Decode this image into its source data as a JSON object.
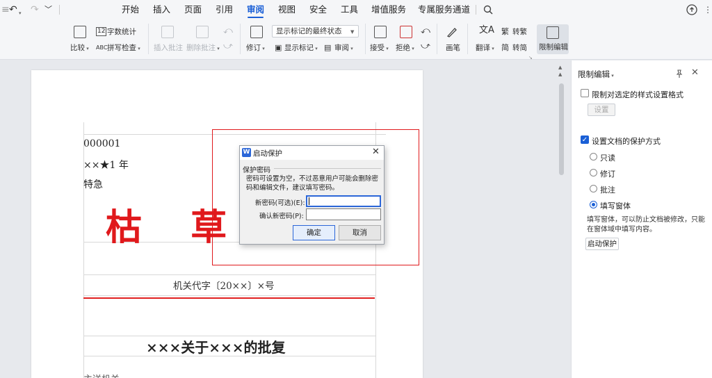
{
  "quick_access": {
    "undo_icon": "↶",
    "redo_icon": "↷"
  },
  "menu": {
    "tabs": [
      "开始",
      "插入",
      "页面",
      "引用",
      "审阅",
      "视图",
      "安全",
      "工具",
      "增值服务",
      "专属服务通道"
    ],
    "active": "审阅"
  },
  "ribbon": {
    "compare": "比较",
    "word_count": "字数统计",
    "spell_check": "拼写检查",
    "insert_comment": "插入批注",
    "delete_comment": "删除批注",
    "track_changes": "修订",
    "markup_select": "显示标记的最终状态",
    "show_markup": "显示标记",
    "review_pane": "审阅",
    "accept": "接受",
    "reject": "拒绝",
    "pen": "画笔",
    "translate": "翻译",
    "to_traditional": "转繁",
    "to_simplified": "转简",
    "restrict_edit": "限制编辑"
  },
  "document": {
    "number": "000001",
    "secret": "××★1 年",
    "urgency": "特急",
    "red_title": "枯 草 仏",
    "doc_code": "机关代字〔20××〕×号",
    "subject": "×××关于×××的批复",
    "recipient": "主送机关:"
  },
  "panel": {
    "title": "限制编辑",
    "format_restrict": "限制对选定的样式设置格式",
    "settings_btn": "设置",
    "protection_mode": "设置文档的保护方式",
    "options": [
      "只读",
      "修订",
      "批注",
      "填写窗体"
    ],
    "selected_option": "填写窗体",
    "description": "填写窗体，可以防止文档被修改，只能在窗体域中填写内容。",
    "start_btn": "启动保护"
  },
  "dialog": {
    "title": "启动保护",
    "section": "保护密码",
    "hint": "密码可设置为空，不过恶意用户可能会删除密码和编辑文件，建议填写密码。",
    "new_password_label": "新密码(可选)(E):",
    "confirm_password_label": "确认新密码(P):",
    "ok": "确定",
    "cancel": "取消"
  }
}
